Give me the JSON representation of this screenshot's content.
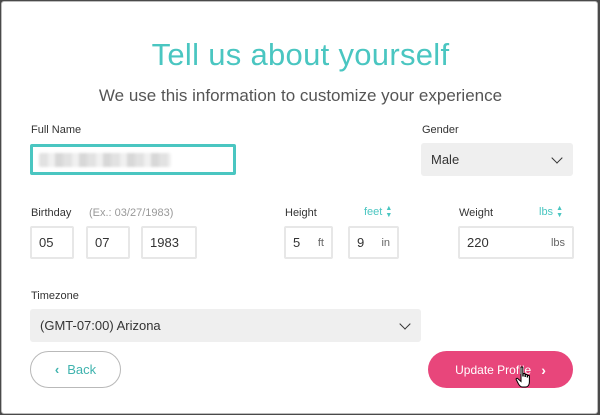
{
  "header": {
    "title": "Tell us about yourself",
    "subtitle": "We use this information to customize your experience"
  },
  "full_name": {
    "label": "Full Name",
    "value": ""
  },
  "gender": {
    "label": "Gender",
    "selected": "Male"
  },
  "birthday": {
    "label": "Birthday",
    "hint": "(Ex.: 03/27/1983)",
    "month": "05",
    "day": "07",
    "year": "1983"
  },
  "height": {
    "label": "Height",
    "unit_toggle": "feet",
    "feet": "5",
    "feet_unit": "ft",
    "inches": "9",
    "inches_unit": "in"
  },
  "weight": {
    "label": "Weight",
    "unit_toggle": "lbs",
    "value": "220",
    "unit": "lbs"
  },
  "timezone": {
    "label": "Timezone",
    "selected": "(GMT-07:00) Arizona"
  },
  "buttons": {
    "back": "Back",
    "update": "Update Profile"
  },
  "colors": {
    "accent": "#4ac6c1",
    "primary_button": "#e8467b"
  }
}
